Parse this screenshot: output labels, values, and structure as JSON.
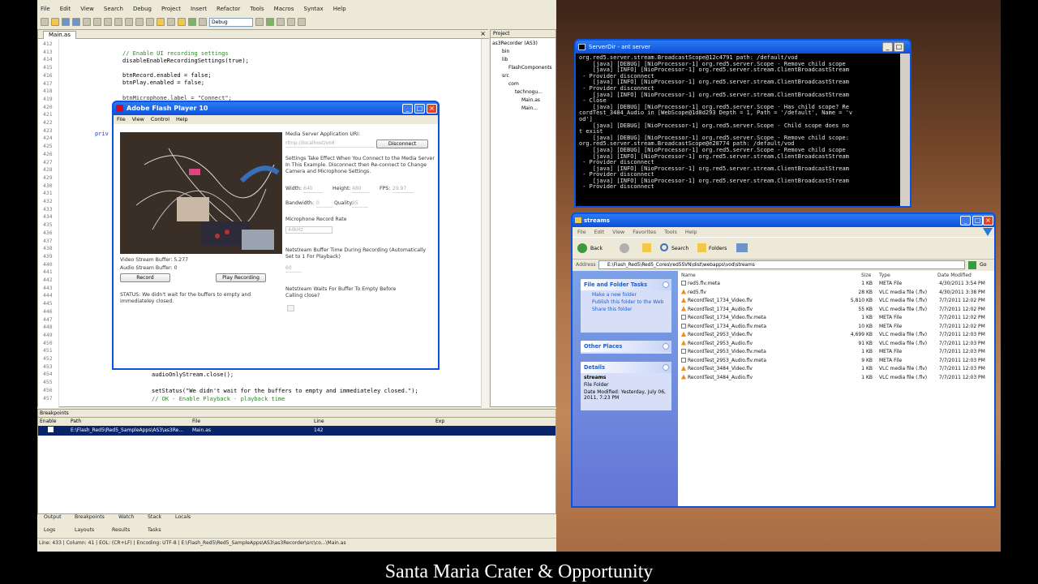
{
  "ide": {
    "menu": [
      "File",
      "Edit",
      "View",
      "Search",
      "Debug",
      "Project",
      "Insert",
      "Refactor",
      "Tools",
      "Macros",
      "Syntax",
      "Help"
    ],
    "config_select": "Debug",
    "editor_tab": "Main.as",
    "line_numbers": [
      "412",
      "413",
      "414",
      "415",
      "416",
      "417",
      "418",
      "419",
      "420",
      "421",
      "422",
      "423",
      "424",
      "425",
      "426",
      "427",
      "428",
      "429",
      "430",
      "431",
      "432",
      "433",
      "434",
      "435",
      "436",
      "437",
      "438",
      "439",
      "440",
      "441",
      "442",
      "443",
      "444",
      "445",
      "446",
      "447",
      "448",
      "449",
      "450",
      "451",
      "452",
      "453",
      "454",
      "455",
      "456",
      "457"
    ],
    "code": {
      "l413": "// Enable UI recording settings",
      "l414": "disableEnableRecordingSettings(true);",
      "l416": "btnRecord.enabled = false;",
      "l417": "btnPlay.enabled = false;",
      "l419": "btnMicrophone.label = \"Connect\";",
      "l423": "priv",
      "l453": "audioOnlyStream.close();",
      "l455": "setStatus(\"We didn't wait for the buffers to empty and immediateley closed.\");",
      "l456": "// OK - Enable Playback - playback time"
    },
    "project": {
      "header": "Project",
      "items": [
        "as3Recorder (AS3)",
        "bin",
        "lib",
        "FlashComponents",
        "src",
        "com",
        "technogu...",
        "Main.as",
        "Main..."
      ]
    },
    "breakpoints": {
      "header": "Breakpoints",
      "columns": [
        "Enable",
        "Path",
        "File",
        "Line",
        "Exp"
      ],
      "row": {
        "path": "E:\\Flash_Red5\\Red5_SampleApps\\AS3\\as3Re...",
        "file": "Main.as",
        "line": "142"
      }
    },
    "bottom_tabs_1": [
      "Output",
      "Breakpoints",
      "Watch",
      "Stack",
      "Locals"
    ],
    "bottom_tabs_2": [
      "Logs",
      "Layouts",
      "Results",
      "Tasks"
    ],
    "status_bar": "Line: 433  |  Column: 41  |  EOL: (CR+LF)  |  Encoding: UTF-8  |  E:\\Flash_Red5\\Red5_SampleApps\\AS3\\as3Recorder\\src\\co...\\Main.as"
  },
  "flash": {
    "title": "Adobe Flash Player 10",
    "menu": [
      "File",
      "View",
      "Control",
      "Help"
    ],
    "media_server_label": "Media Server Application URI:",
    "media_server_uri": "rtmp://localhost/vod",
    "disconnect_label": "Disconnect",
    "settings_note": "Settings Take Effect When You Connect to the Media Server In This Example. Disconnect then Re-connect to Change Camera and Microphone Settings.",
    "width_label": "Width:",
    "width_value": "640",
    "height_label": "Height:",
    "height_value": "480",
    "fps_label": "FPS:",
    "fps_value": "29.97",
    "bandwidth_label": "Bandwidth:",
    "bandwidth_value": "0",
    "quality_label": "Quality:",
    "quality_value": "95",
    "mic_rate_label": "Microphone Record Rate",
    "mic_rate_value": "44kHz",
    "buffer_label": "Netstream Buffer Time During Recording (Automatically Set to 1 For Playback)",
    "buffer_value": "60",
    "wait_label": "Netstream Waits For Buffer To Empty Before Calling close?",
    "video_buffer": "Video Stream Buffer: 5.277",
    "audio_buffer": "Audio Stream Buffer: 0",
    "record_label": "Record",
    "play_label": "Play Recording",
    "status_text": "STATUS: We didn't wait for the buffers to empty and immediateley closed."
  },
  "server": {
    "title": "ServerDir - ant server",
    "lines": [
      "org.red5.server.stream.BroadcastScope@12c4791 path: /default/vod",
      "    [java] [DEBUG] [NioProcessor-1] org.red5.server.Scope - Remove child scope",
      "    [java] [INFO] [NioProcessor-1] org.red5.server.stream.ClientBroadcastStream",
      " - Provider disconnect",
      "    [java] [INFO] [NioProcessor-1] org.red5.server.stream.ClientBroadcastStream",
      " - Provider disconnect",
      "    [java] [INFO] [NioProcessor-1] org.red5.server.stream.ClientBroadcastStream",
      " - Close",
      "    [java] [DEBUG] [NioProcessor-1] org.red5.server.Scope - Has child scope? Re",
      "cordTest_3484_Audio in [WebScope@1d8d293 Depth = 1, Path = '/default', Name = 'v",
      "od']",
      "    [java] [DEBUG] [NioProcessor-1] org.red5.server.Scope - Child scope does no",
      "t exist",
      "    [java] [DEBUG] [NioProcessor-1] org.red5.server.Scope - Remove child scope:",
      "org.red5.server.stream.BroadcastScope@e28774 path: /default/vod",
      "    [java] [DEBUG] [NioProcessor-1] org.red5.server.Scope - Remove child scope",
      "    [java] [INFO] [NioProcessor-1] org.red5.server.stream.ClientBroadcastStream",
      " - Provider disconnect",
      "    [java] [INFO] [NioProcessor-1] org.red5.server.stream.ClientBroadcastStream",
      " - Provider disconnect",
      "    [java] [INFO] [NioProcessor-1] org.red5.server.stream.ClientBroadcastStream",
      " - Provider disconnect"
    ]
  },
  "explorer": {
    "title": "streams",
    "menu": [
      "File",
      "Edit",
      "View",
      "Favorites",
      "Tools",
      "Help"
    ],
    "back_label": "Back",
    "search_label": "Search",
    "folders_label": "Folders",
    "address_label": "Address",
    "address": "E:\\Flash_Red5\\Red5_Cores\\red5SVN\\dist\\webapps\\vod\\streams",
    "go_label": "Go",
    "task_header": "File and Folder Tasks",
    "tasks": [
      "Make a new folder",
      "Publish this folder to the Web",
      "Share this folder"
    ],
    "other_header": "Other Places",
    "details_header": "Details",
    "details_name": "streams",
    "details_type": "File Folder",
    "details_modified": "Date Modified: Yesterday, July 06, 2011, 7:23 PM",
    "columns": [
      "Name",
      "Size",
      "Type",
      "Date Modified"
    ],
    "files": [
      {
        "name": "red5.flv.meta",
        "size": "1 KB",
        "type": "META File",
        "date": "4/30/2011 3:54 PM",
        "icon": "meta"
      },
      {
        "name": "red5.flv",
        "size": "28 KB",
        "type": "VLC media file (.flv)",
        "date": "4/30/2011 3:38 PM",
        "icon": "vlc"
      },
      {
        "name": "RecordTest_1734_Video.flv",
        "size": "5,810 KB",
        "type": "VLC media file (.flv)",
        "date": "7/7/2011 12:02 PM",
        "icon": "vlc"
      },
      {
        "name": "RecordTest_1734_Audio.flv",
        "size": "55 KB",
        "type": "VLC media file (.flv)",
        "date": "7/7/2011 12:02 PM",
        "icon": "vlc"
      },
      {
        "name": "RecordTest_1734_Video.flv.meta",
        "size": "1 KB",
        "type": "META File",
        "date": "7/7/2011 12:02 PM",
        "icon": "meta"
      },
      {
        "name": "RecordTest_1734_Audio.flv.meta",
        "size": "10 KB",
        "type": "META File",
        "date": "7/7/2011 12:02 PM",
        "icon": "meta"
      },
      {
        "name": "RecordTest_2953_Video.flv",
        "size": "4,699 KB",
        "type": "VLC media file (.flv)",
        "date": "7/7/2011 12:03 PM",
        "icon": "vlc"
      },
      {
        "name": "RecordTest_2953_Audio.flv",
        "size": "91 KB",
        "type": "VLC media file (.flv)",
        "date": "7/7/2011 12:03 PM",
        "icon": "vlc"
      },
      {
        "name": "RecordTest_2953_Video.flv.meta",
        "size": "1 KB",
        "type": "META File",
        "date": "7/7/2011 12:03 PM",
        "icon": "meta"
      },
      {
        "name": "RecordTest_2953_Audio.flv.meta",
        "size": "9 KB",
        "type": "META File",
        "date": "7/7/2011 12:03 PM",
        "icon": "meta"
      },
      {
        "name": "RecordTest_3484_Video.flv",
        "size": "1 KB",
        "type": "VLC media file (.flv)",
        "date": "7/7/2011 12:03 PM",
        "icon": "vlc"
      },
      {
        "name": "RecordTest_3484_Audio.flv",
        "size": "1 KB",
        "type": "VLC media file (.flv)",
        "date": "7/7/2011 12:03 PM",
        "icon": "vlc"
      }
    ]
  },
  "caption": "Santa Maria Crater  &  Opportunity",
  "colors": {
    "xp_blue": "#0b53e0",
    "console_bg": "#000000",
    "comment": "#2a8a2a"
  }
}
